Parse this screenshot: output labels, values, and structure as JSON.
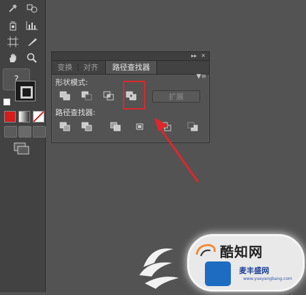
{
  "panel": {
    "tabs": [
      "变换",
      "对齐",
      "路径查找器"
    ],
    "active_tab": "路径查找器",
    "collapse_icon": "double-chevron-right-icon",
    "close_icon": "close-x-icon",
    "menu_icon": "panel-menu-icon",
    "shape_modes_label": "形状模式:",
    "pathfinders_label": "路径查找器:",
    "expand_label": "扩展",
    "shape_modes": [
      "unite-icon",
      "minus-front-icon",
      "intersect-icon",
      "exclude-icon"
    ],
    "pathfinders": [
      "divide-icon",
      "trim-icon",
      "merge-icon",
      "crop-icon",
      "outline-icon",
      "minus-back-icon"
    ]
  },
  "toolbar": {
    "help_label": "?",
    "icons": [
      "eyedropper-icon",
      "blend-icon",
      "symbol-sprayer-icon",
      "column-graph-icon",
      "artboard-icon",
      "slice-icon",
      "hand-icon",
      "zoom-icon"
    ]
  },
  "annotation": {
    "highlight_color": "#e0262b",
    "arrow_color": "#e0262b"
  },
  "watermark": {
    "main_text": "酷知网",
    "sub_text": "麦丰盛网",
    "url_text": "www.yueyangbang.com"
  },
  "colors": {
    "background": "#535353",
    "toolbar": "#424242",
    "accent_red": "#e0262b"
  }
}
